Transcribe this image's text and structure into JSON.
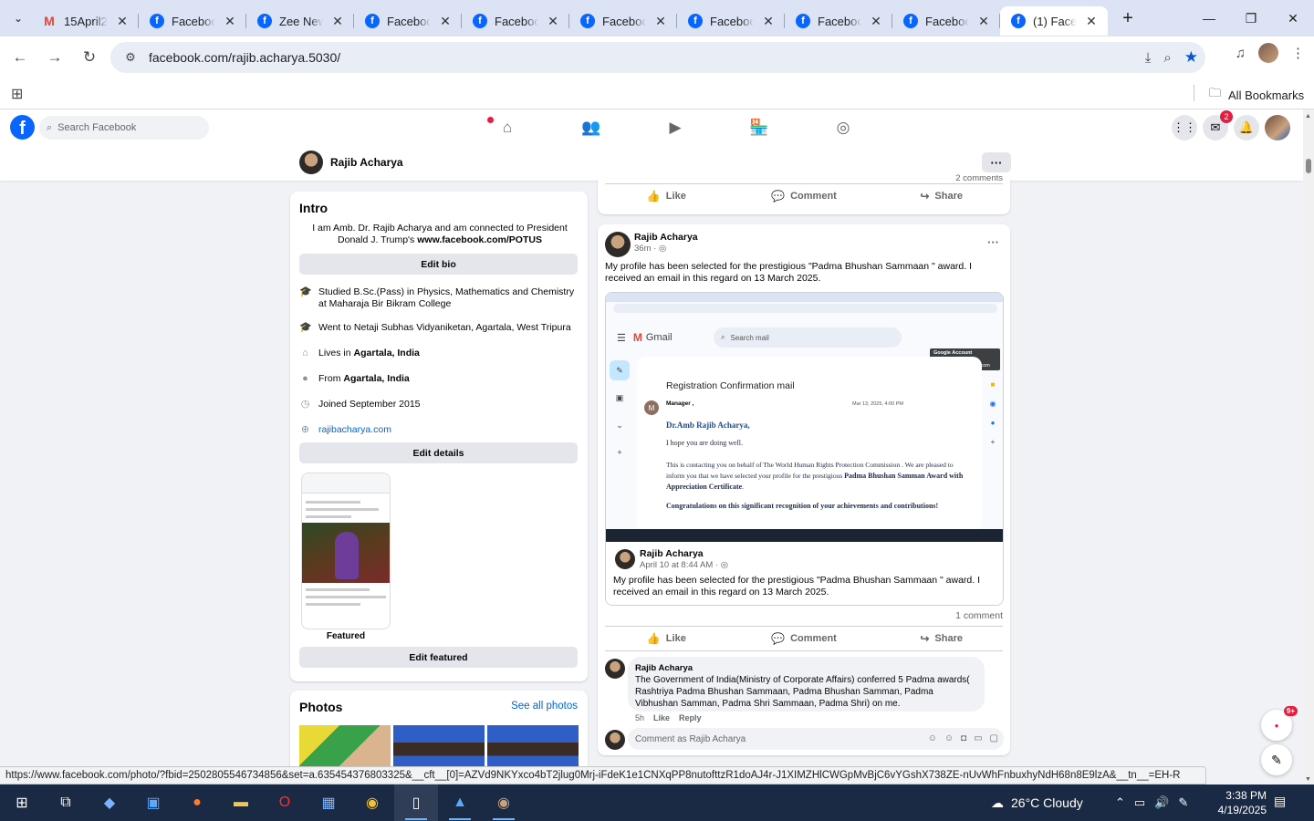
{
  "browser": {
    "tabs": [
      {
        "title": "15April2025",
        "icon": "gmail-icon"
      },
      {
        "title": "Facebook",
        "icon": "facebook-icon"
      },
      {
        "title": "Zee News",
        "icon": "facebook-icon"
      },
      {
        "title": "Facebook",
        "icon": "facebook-icon"
      },
      {
        "title": "Facebook",
        "icon": "facebook-icon"
      },
      {
        "title": "Facebook",
        "icon": "facebook-icon"
      },
      {
        "title": "Facebook",
        "icon": "facebook-icon"
      },
      {
        "title": "Facebook",
        "icon": "facebook-icon"
      },
      {
        "title": "Facebook",
        "icon": "facebook-icon"
      },
      {
        "title": "(1) Facebook",
        "icon": "facebook-icon",
        "active": true
      }
    ],
    "url": "facebook.com/rajib.acharya.5030/",
    "bookmarks_label": "All Bookmarks",
    "status_url": "https://www.facebook.com/photo/?fbid=2502805546734856&set=a.635454376803325&__cft__[0]=AZVd9NKYxco4bT2jlug0Mrj-iFdeK1e1CNXqPP8nutofttzR1doAJ4r-J1XIMZHlCWGpMvBjC6vYGshX738ZE-nUvWhFnbuxhyNdH68n8E9lzA&__tn__=EH-R"
  },
  "fb": {
    "search_placeholder": "Search Facebook",
    "messenger_badge": "2",
    "colors": {
      "brand": "#0866ff",
      "badge": "#e41e3f",
      "link": "#0064d1"
    }
  },
  "profile": {
    "name": "Rajib Acharya",
    "more_label": "···"
  },
  "intro": {
    "title": "Intro",
    "bio": "I am Amb. Dr. Rajib Acharya and am connected to President Donald J. Trump's ",
    "bio_link": "www.facebook.com/POTUS",
    "edit_bio": "Edit bio",
    "items": [
      {
        "icon": "graduation-cap-icon",
        "text": "Studied B.Sc.(Pass) in Physics, Mathematics and Chemistry at Maharaja Bir Bikram College"
      },
      {
        "icon": "graduation-cap-icon",
        "text": "Went to Netaji Subhas Vidyaniketan, Agartala, West Tripura"
      },
      {
        "icon": "home-icon",
        "prefix": "Lives in ",
        "bold": "Agartala, India"
      },
      {
        "icon": "location-pin-icon",
        "prefix": "From ",
        "bold": "Agartala, India"
      },
      {
        "icon": "clock-icon",
        "text": "Joined September 2015"
      },
      {
        "icon": "globe-icon",
        "link": "rajibacharya.com"
      }
    ],
    "edit_details": "Edit details",
    "featured_label": "Featured",
    "edit_featured": "Edit featured"
  },
  "photos": {
    "title": "Photos",
    "see_all": "See all photos"
  },
  "post_top": {
    "comments_partial": "2 comments",
    "like": "Like",
    "comment": "Comment",
    "share": "Share"
  },
  "post": {
    "author": "Rajib Acharya",
    "time": "36m",
    "text": "My profile has been selected for the prestigious \"Padma Bhushan Sammaan \" award. I received an email in this regard on 13 March 2025.",
    "screenshot": {
      "app": "Gmail",
      "search": "Search mail",
      "account_tip_1": "Google Account",
      "account_tip_2": "rajib acharya",
      "account_tip_3": "rafreedom32@gmail.com",
      "subject": "Registration Confirmation mail",
      "sender_initial": "M",
      "sender": "Manager ,",
      "date": "Mar 13, 2025, 4:00 PM",
      "greeting": "Dr.Amb Rajib Acharya,",
      "line1": "I hope you are doing well.",
      "para_a": "This is contacting you on behalf of The World Human Rights Protection Commission . We are pleased to inform you that we have selected your profile for the prestigious ",
      "para_bold": "Padma Bhushan Samman Award with Appreciation Certificate",
      "congrats": "Congratulations on this significant recognition of your achievements and contributions!"
    },
    "shared_author": "Rajib Acharya",
    "shared_time": "April 10 at 8:44 AM",
    "shared_text": "My profile has been selected for the prestigious \"Padma Bhushan Sammaan \" award. I received an email in this regard on 13 March 2025.",
    "comment_count": "1 comment",
    "like": "Like",
    "comment": "Comment",
    "share": "Share",
    "comment_author": "Rajib Acharya",
    "comment_text": "The Government of India(Ministry of Corporate Affairs) conferred 5 Padma awards( Rashtriya Padma Bhushan Sammaan, Padma Bhushan Samman, Padma Vibhushan Samman, Padma Shri Sammaan, Padma Shri) on me.",
    "comment_time": "5h",
    "comment_like": "Like",
    "comment_reply": "Reply",
    "write_placeholder": "Comment as Rajib Acharya"
  },
  "news_badge": "9+",
  "taskbar": {
    "weather": "26°C  Cloudy",
    "time": "3:38 PM",
    "date": "4/19/2025"
  }
}
